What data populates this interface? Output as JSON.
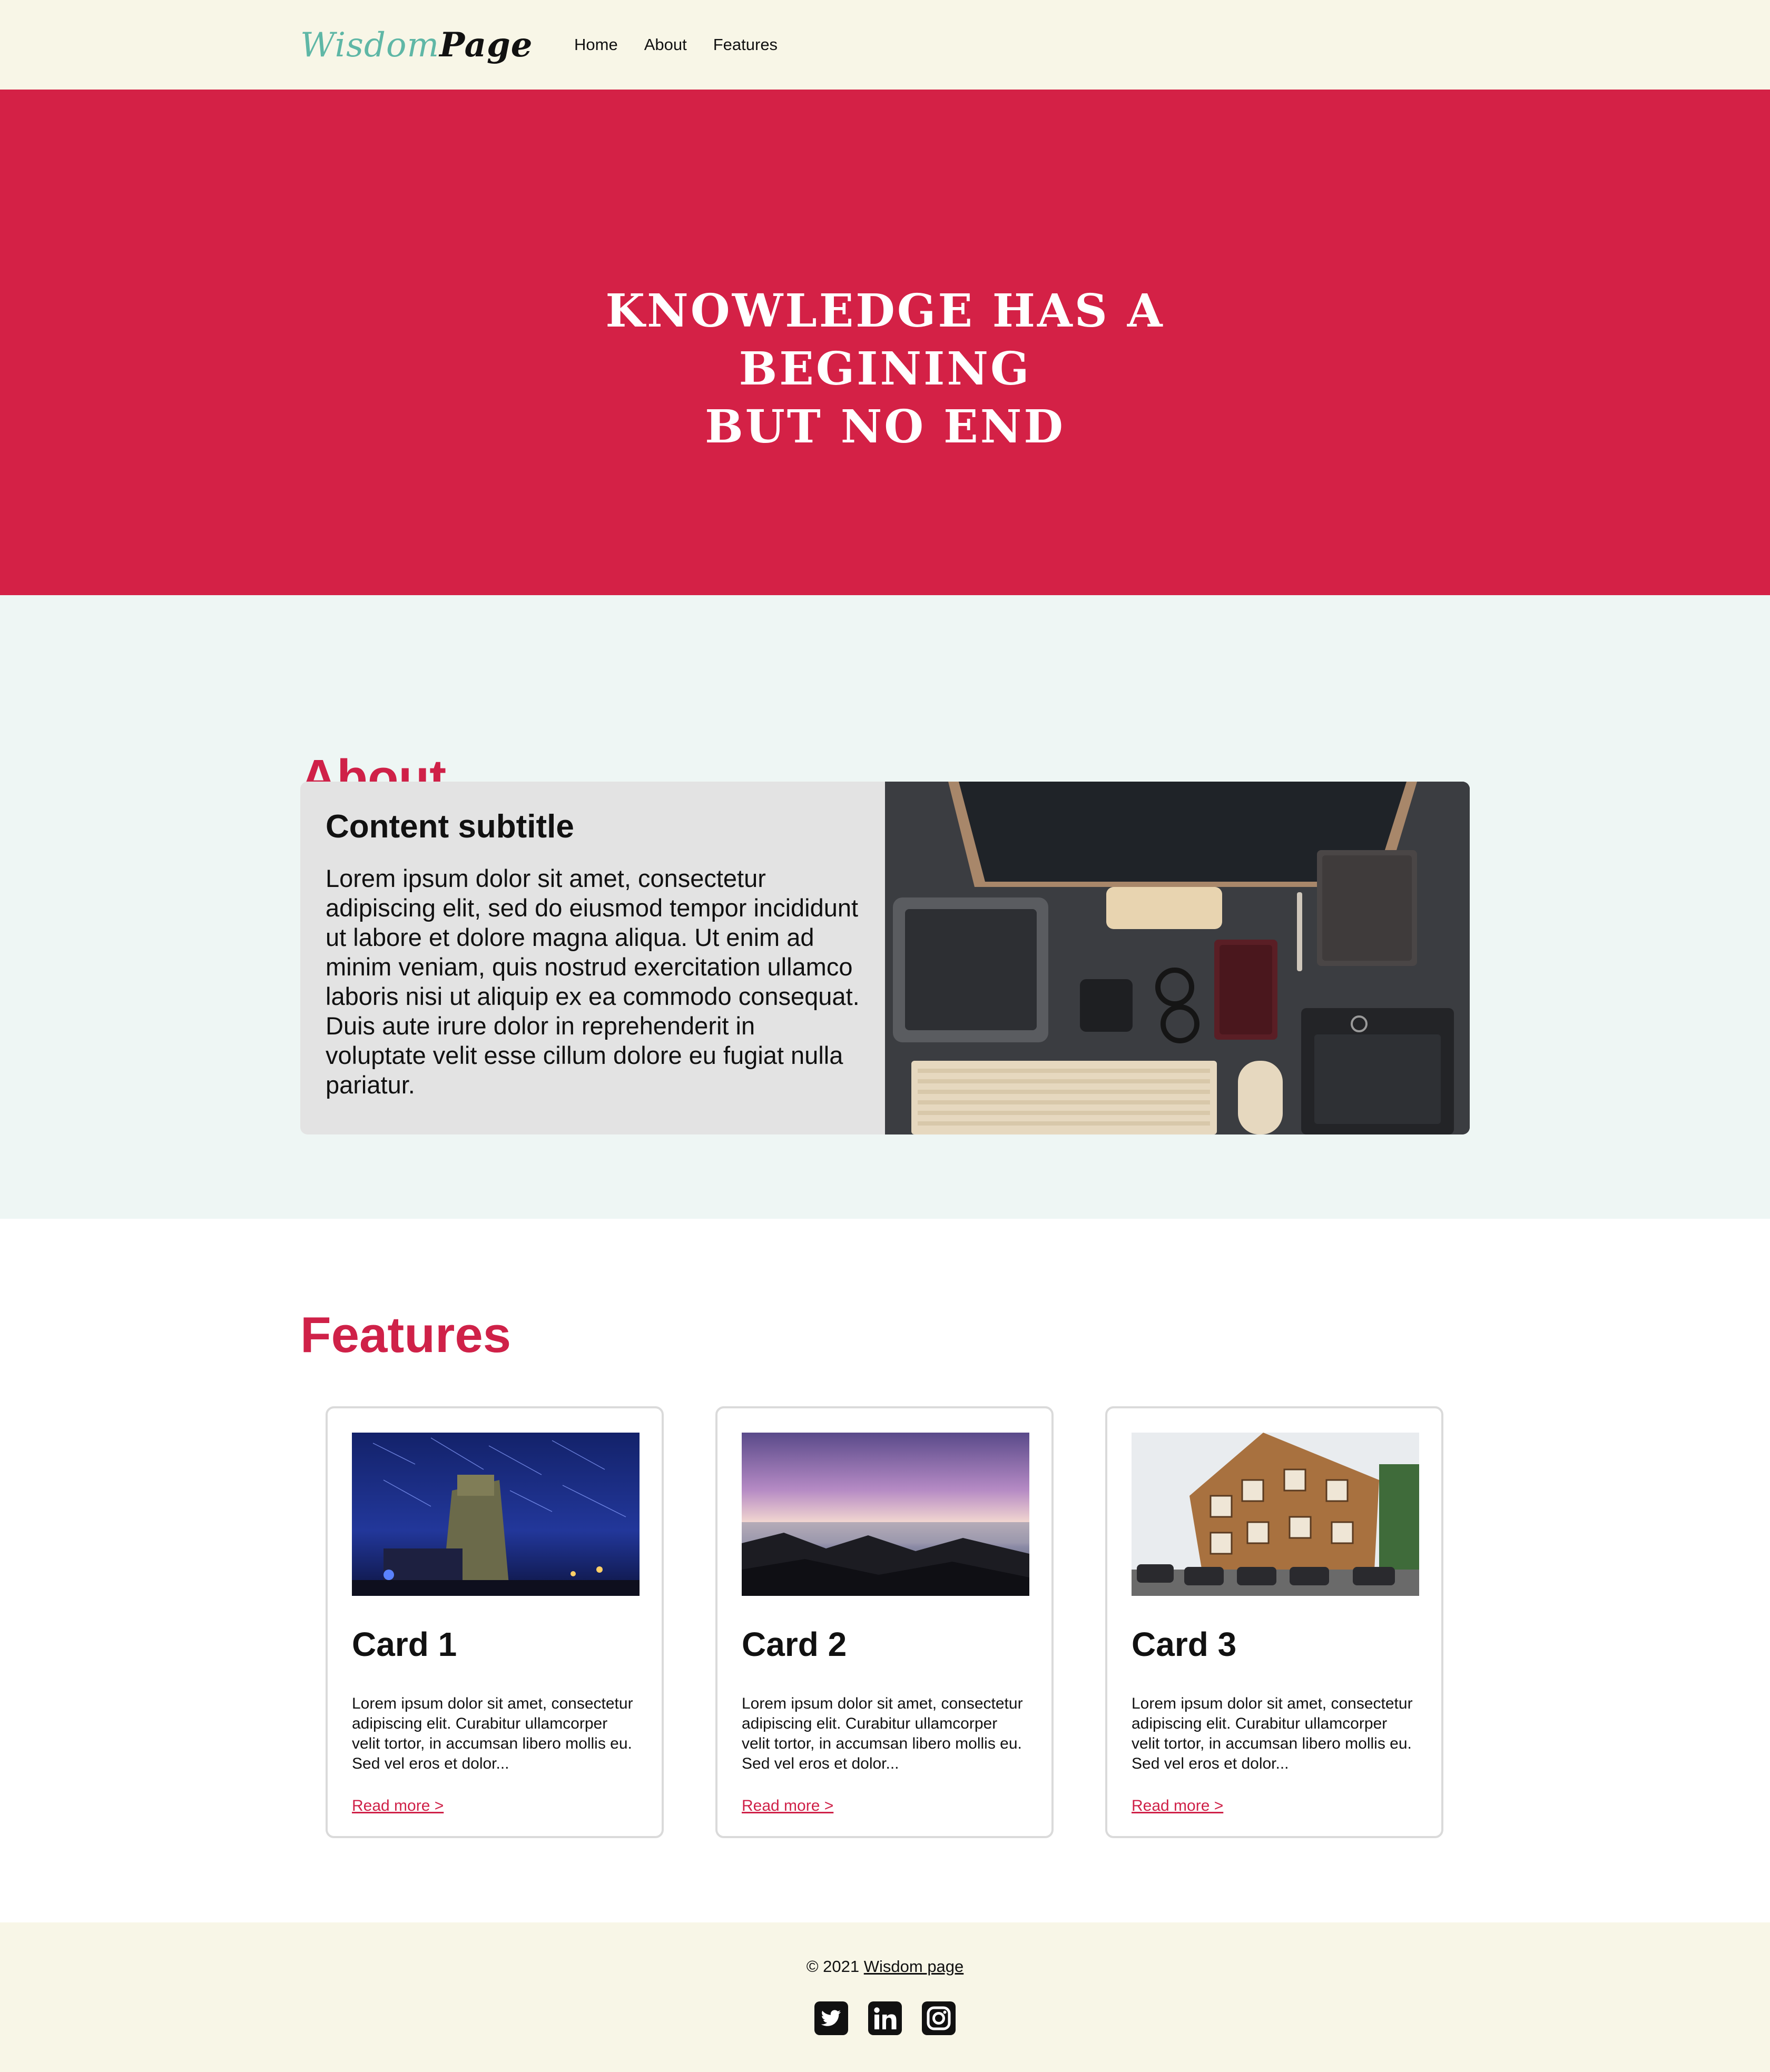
{
  "header": {
    "logo_part1": "Wisdom",
    "logo_part2": "Page",
    "nav": [
      "Home",
      "About",
      "Features"
    ]
  },
  "hero": {
    "title_line1": "KNOWLEDGE HAS A BEGINING",
    "title_line2": "BUT NO END",
    "color": "#d42146"
  },
  "about": {
    "title": "About",
    "subtitle": "Content subtitle",
    "body": "Lorem ipsum dolor sit amet, consectetur adipiscing elit, sed do eiusmod tempor incididunt ut labore et dolore magna aliqua. Ut enim ad minim veniam, quis nostrud exercitation ullamco laboris nisi ut aliquip ex ea commodo consequat. Duis aute irure dolor in reprehenderit in voluptate velit esse cillum dolore eu fugiat nulla pariatur."
  },
  "features": {
    "title": "Features",
    "cards": [
      {
        "title": "Card 1",
        "text": "Lorem ipsum dolor sit amet, consectetur adipiscing elit. Curabitur ullamcorper velit tortor, in accumsan libero mollis eu. Sed vel eros et dolor...",
        "link": "Read more >"
      },
      {
        "title": "Card 2",
        "text": "Lorem ipsum dolor sit amet, consectetur adipiscing elit. Curabitur ullamcorper velit tortor, in accumsan libero mollis eu. Sed vel eros et dolor...",
        "link": "Read more >"
      },
      {
        "title": "Card 3",
        "text": "Lorem ipsum dolor sit amet, consectetur adipiscing elit. Curabitur ullamcorper velit tortor, in accumsan libero mollis eu. Sed vel eros et dolor...",
        "link": "Read more >"
      }
    ]
  },
  "footer": {
    "copyright": "© 2021",
    "link": "Wisdom page",
    "social": [
      "twitter-icon",
      "linkedin-icon",
      "instagram-icon"
    ]
  },
  "colors": {
    "accent": "#cf2148",
    "header_bg": "#f8f6e7",
    "about_bg": "#eef6f4",
    "logo_teal": "#5fb7a6"
  }
}
